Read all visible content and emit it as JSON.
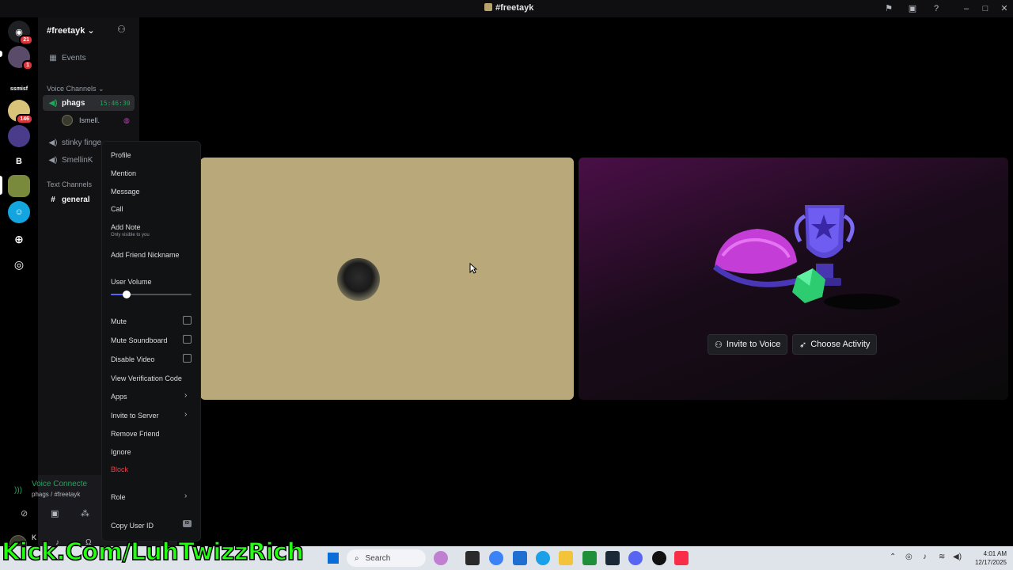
{
  "window": {
    "title": "#freetayk"
  },
  "rail": {
    "dm_badge": "21",
    "avatar_badge": "1",
    "text_label": "ssmisf",
    "server_badge": "146",
    "letter_server": "B"
  },
  "sidebar": {
    "guild_name": "#freetayk",
    "events_label": "Events",
    "voice_category": "Voice Channels",
    "voice_channels": [
      {
        "name": "phags",
        "timer": "15:46:30"
      },
      {
        "name": "stinky finge"
      },
      {
        "name": "SmellinK"
      }
    ],
    "voice_user": "Ismell.",
    "text_category": "Text Channels",
    "text_channels": [
      {
        "name": "general"
      }
    ],
    "voice_status": "Voice Connecte",
    "voice_location": "phags / #freetayk",
    "user_initial": "K"
  },
  "context_menu": {
    "profile": "Profile",
    "mention": "Mention",
    "message": "Message",
    "call": "Call",
    "add_note": "Add Note",
    "add_note_sub": "Only visible to you",
    "add_friend_nickname": "Add Friend Nickname",
    "user_volume": "User Volume",
    "user_volume_level": 0.2,
    "mute": "Mute",
    "mute_soundboard": "Mute Soundboard",
    "disable_video": "Disable Video",
    "view_verification_code": "View Verification Code",
    "apps": "Apps",
    "invite_to_server": "Invite to Server",
    "remove_friend": "Remove Friend",
    "ignore": "Ignore",
    "block": "Block",
    "role": "Role",
    "copy_user_id": "Copy User ID",
    "id_badge": "ID"
  },
  "activity": {
    "invite_label": "Invite to Voice",
    "choose_label": "Choose Activity"
  },
  "taskbar": {
    "search_placeholder": "Search",
    "time": "4:01 AM",
    "date": "12/17/2025"
  },
  "overlay_text": "Kick.Com/LuhTwizzRich",
  "colors": {
    "left_tile": "#b9a97a",
    "danger": "#f23f43",
    "overlay": "#22ff10",
    "online": "#23a55a"
  }
}
